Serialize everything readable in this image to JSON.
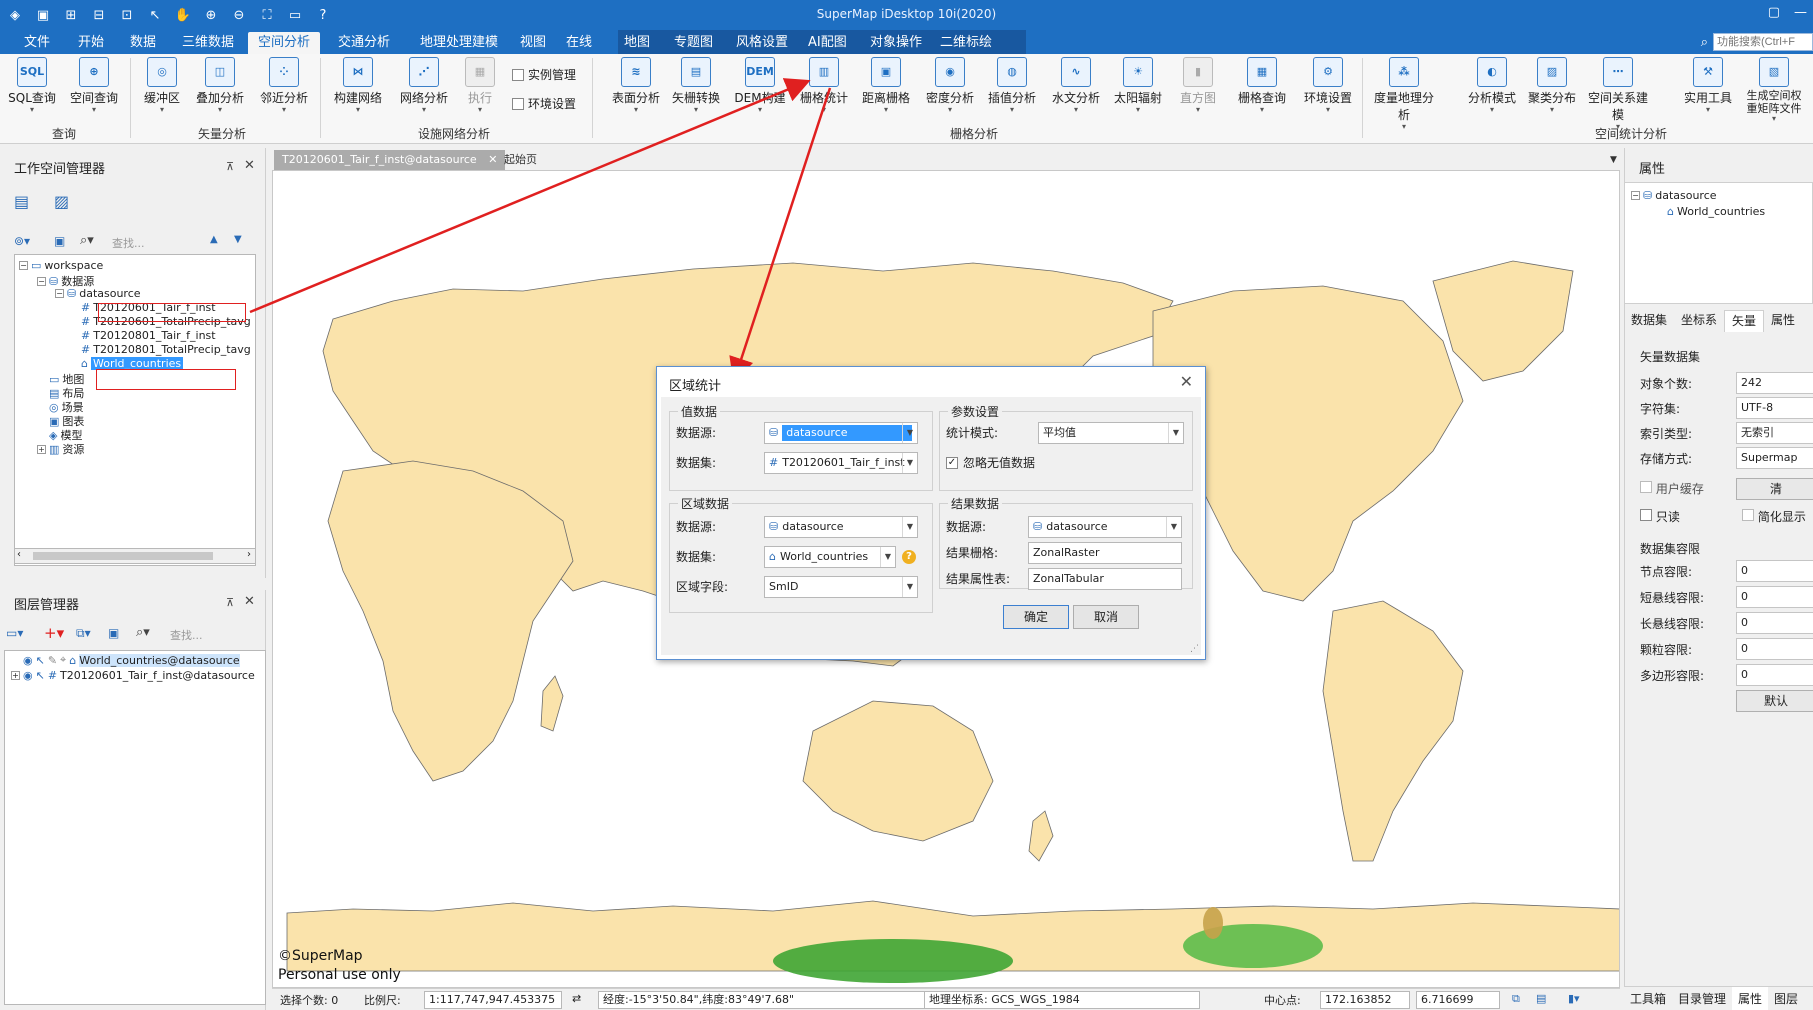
{
  "app": {
    "title": "SuperMap iDesktop 10i(2020)"
  },
  "menu": {
    "tabs": [
      "文件",
      "开始",
      "数据",
      "三维数据",
      "空间分析",
      "交通分析",
      "地理处理建模",
      "视图",
      "在线",
      "地图",
      "专题图",
      "风格设置",
      "AI配图",
      "对象操作",
      "二维标绘"
    ],
    "active": "空间分析",
    "search_placeholder": "功能搜索(Ctrl+F"
  },
  "ribbon": {
    "buttons": [
      {
        "label": "SQL查询",
        "icon": "SQL"
      },
      {
        "label": "空间查询",
        "icon": "⊕"
      },
      {
        "label": "缓冲区",
        "icon": "◎"
      },
      {
        "label": "叠加分析",
        "icon": "◫"
      },
      {
        "label": "邻近分析",
        "icon": "⁘"
      },
      {
        "label": "构建网络",
        "icon": "⋈"
      },
      {
        "label": "网络分析",
        "icon": "⋰"
      },
      {
        "label": "执行",
        "icon": "▦"
      },
      {
        "label": "表面分析",
        "icon": "≋"
      },
      {
        "label": "矢栅转换",
        "icon": "▤"
      },
      {
        "label": "DEM构建",
        "icon": "DEM"
      },
      {
        "label": "栅格统计",
        "icon": "▥"
      },
      {
        "label": "距离栅格",
        "icon": "▣"
      },
      {
        "label": "密度分析",
        "icon": "◉"
      },
      {
        "label": "插值分析",
        "icon": "◍"
      },
      {
        "label": "水文分析",
        "icon": "∿"
      },
      {
        "label": "太阳辐射",
        "icon": "☀"
      },
      {
        "label": "直方图",
        "icon": "▮"
      },
      {
        "label": "栅格查询",
        "icon": "▦"
      },
      {
        "label": "环境设置",
        "icon": "⚙"
      },
      {
        "label": "度量地理分析",
        "icon": "⁂"
      },
      {
        "label": "分析模式",
        "icon": "◐"
      },
      {
        "label": "聚类分布",
        "icon": "▨"
      },
      {
        "label": "空间关系建模",
        "icon": "⋯"
      },
      {
        "label": "实用工具",
        "icon": "⚒"
      },
      {
        "label": "生成空间权重矩阵文件",
        "icon": "▧"
      }
    ],
    "checks": [
      "实例管理",
      "环境设置"
    ],
    "groups": [
      "查询",
      "矢量分析",
      "设施网络分析",
      "栅格分析",
      "空间统计分析"
    ]
  },
  "workspace": {
    "title": "工作空间管理器",
    "search_placeholder": "查找...",
    "tree": {
      "root": "workspace",
      "datasources": "数据源",
      "datasource": "datasource",
      "datasets": [
        "T20120601_Tair_f_inst",
        "T20120601_TotalPrecip_tavg",
        "T20120801_Tair_f_inst",
        "T20120801_TotalPrecip_tavg",
        "World_countries"
      ],
      "others": [
        "地图",
        "布局",
        "场景",
        "图表",
        "模型",
        "资源"
      ]
    }
  },
  "layers": {
    "title": "图层管理器",
    "search_placeholder": "查找...",
    "items": [
      "World_countries@datasource",
      "T20120601_Tair_f_inst@datasource"
    ]
  },
  "doc_tabs": [
    "T20120601_Tair_f_inst@datasource",
    "起始页"
  ],
  "map": {
    "copyright": "©SuperMap",
    "license": "Personal use only"
  },
  "status": {
    "selected_label": "选择个数: 0",
    "scale_label": "比例尺:",
    "scale": "1:117,747,947.453375",
    "coords": "经度:-15°3'50.84\",纬度:83°49'7.68\"",
    "crs": "地理坐标系: GCS_WGS_1984",
    "center_label": "中心点:",
    "center_x": "172.163852",
    "center_y": "6.716699"
  },
  "properties": {
    "title": "属性",
    "tree_root": "datasource",
    "tree_child": "World_countries",
    "tabs": [
      "数据集",
      "坐标系",
      "矢量",
      "属性"
    ],
    "active_tab": "矢量",
    "vector_section": "矢量数据集",
    "rows": [
      {
        "label": "对象个数:",
        "value": "242"
      },
      {
        "label": "字符集:",
        "value": "UTF-8"
      },
      {
        "label": "索引类型:",
        "value": "无索引"
      },
      {
        "label": "存储方式:",
        "value": "Supermap"
      }
    ],
    "user_cache": "用户缓存",
    "clear_btn": "清",
    "readonly": "只读",
    "simplify": "简化显示",
    "tolerance_section": "数据集容限",
    "tolerances": [
      {
        "label": "节点容限:",
        "value": "0"
      },
      {
        "label": "短悬线容限:",
        "value": "0"
      },
      {
        "label": "长悬线容限:",
        "value": "0"
      },
      {
        "label": "颗粒容限:",
        "value": "0"
      },
      {
        "label": "多边形容限:",
        "value": "0"
      }
    ],
    "default_btn": "默认",
    "bottom_tabs": [
      "工具箱",
      "目录管理",
      "属性",
      "图层"
    ]
  },
  "dialog": {
    "title": "区域统计",
    "value_data": {
      "legend": "值数据",
      "datasource_label": "数据源:",
      "datasource": "datasource",
      "dataset_label": "数据集:",
      "dataset": "T20120601_Tair_f_inst"
    },
    "params": {
      "legend": "参数设置",
      "mode_label": "统计模式:",
      "mode": "平均值",
      "ignore_nodata": "忽略无值数据"
    },
    "zone_data": {
      "legend": "区域数据",
      "datasource_label": "数据源:",
      "datasource": "datasource",
      "dataset_label": "数据集:",
      "dataset": "World_countries",
      "field_label": "区域字段:",
      "field": "SmID"
    },
    "result": {
      "legend": "结果数据",
      "datasource_label": "数据源:",
      "datasource": "datasource",
      "raster_label": "结果栅格:",
      "raster": "ZonalRaster",
      "table_label": "结果属性表:",
      "table": "ZonalTabular"
    },
    "ok": "确定",
    "cancel": "取消"
  },
  "colors": {
    "accent": "#1e6fc2",
    "land": "#fae3ab",
    "annotation": "#e02020",
    "green": "#3fa534"
  }
}
